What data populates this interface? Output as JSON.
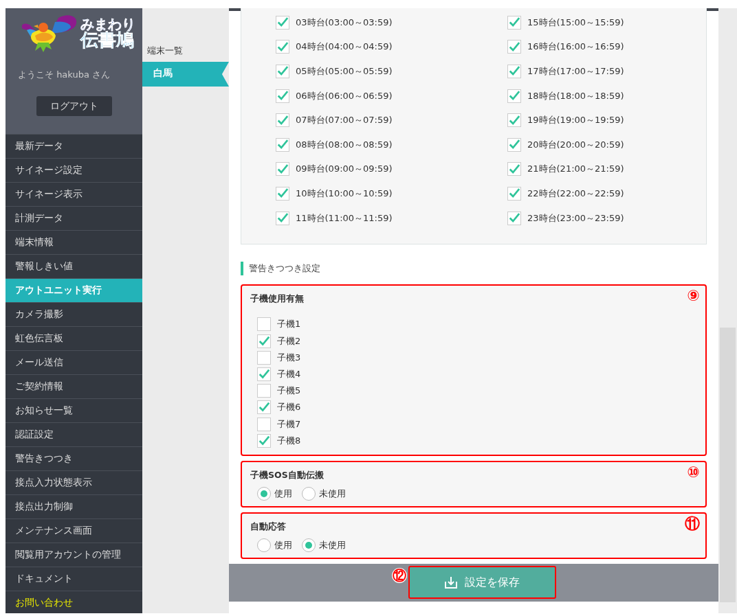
{
  "logo": {
    "line1": "みまわり",
    "line2": "伝書鳩"
  },
  "welcome": "ようこそ hakuba さん",
  "logout": "ログアウト",
  "menu": [
    {
      "label": "最新データ",
      "selected": false,
      "kind": "normal"
    },
    {
      "label": "サイネージ設定",
      "selected": false,
      "kind": "normal"
    },
    {
      "label": "サイネージ表示",
      "selected": false,
      "kind": "normal"
    },
    {
      "label": "計測データ",
      "selected": false,
      "kind": "normal"
    },
    {
      "label": "端末情報",
      "selected": false,
      "kind": "normal"
    },
    {
      "label": "警報しきい値",
      "selected": false,
      "kind": "normal"
    },
    {
      "label": "アウトユニット実行",
      "selected": true,
      "kind": "normal"
    },
    {
      "label": "カメラ撮影",
      "selected": false,
      "kind": "normal"
    },
    {
      "label": "虹色伝言板",
      "selected": false,
      "kind": "normal"
    },
    {
      "label": "メール送信",
      "selected": false,
      "kind": "normal"
    },
    {
      "label": "ご契約情報",
      "selected": false,
      "kind": "normal"
    },
    {
      "label": "お知らせ一覧",
      "selected": false,
      "kind": "normal"
    },
    {
      "label": "認証設定",
      "selected": false,
      "kind": "normal"
    },
    {
      "label": "警告きつつき",
      "selected": false,
      "kind": "normal"
    },
    {
      "label": "接点入力状態表示",
      "selected": false,
      "kind": "normal"
    },
    {
      "label": "接点出力制御",
      "selected": false,
      "kind": "normal"
    },
    {
      "label": "メンテナンス画面",
      "selected": false,
      "kind": "normal"
    },
    {
      "label": "閲覧用アカウントの管理",
      "selected": false,
      "kind": "normal"
    },
    {
      "label": "ドキュメント",
      "selected": false,
      "kind": "normal"
    },
    {
      "label": "お問い合わせ",
      "selected": false,
      "kind": "contact"
    }
  ],
  "terminal_list": {
    "title": "端末一覧",
    "items": [
      {
        "label": "白馬",
        "selected": true
      }
    ]
  },
  "hours": [
    {
      "label": "03時台(03:00～03:59)",
      "checked": true
    },
    {
      "label": "04時台(04:00～04:59)",
      "checked": true
    },
    {
      "label": "05時台(05:00～05:59)",
      "checked": true
    },
    {
      "label": "06時台(06:00～06:59)",
      "checked": true
    },
    {
      "label": "07時台(07:00～07:59)",
      "checked": true
    },
    {
      "label": "08時台(08:00～08:59)",
      "checked": true
    },
    {
      "label": "09時台(09:00～09:59)",
      "checked": true
    },
    {
      "label": "10時台(10:00～10:59)",
      "checked": true
    },
    {
      "label": "11時台(11:00～11:59)",
      "checked": true
    },
    {
      "label": "15時台(15:00～15:59)",
      "checked": true
    },
    {
      "label": "16時台(16:00～16:59)",
      "checked": true
    },
    {
      "label": "17時台(17:00～17:59)",
      "checked": true
    },
    {
      "label": "18時台(18:00～18:59)",
      "checked": true
    },
    {
      "label": "19時台(19:00～19:59)",
      "checked": true
    },
    {
      "label": "20時台(20:00～20:59)",
      "checked": true
    },
    {
      "label": "21時台(21:00～21:59)",
      "checked": true
    },
    {
      "label": "22時台(22:00～22:59)",
      "checked": true
    },
    {
      "label": "23時台(23:00～23:59)",
      "checked": true
    }
  ],
  "section_title": "警告きつつき設定",
  "groups": [
    {
      "kind": "checkboxes",
      "title": "子機使用有無",
      "marker": "⑨",
      "options": [
        {
          "label": "子機1",
          "checked": false
        },
        {
          "label": "子機2",
          "checked": true
        },
        {
          "label": "子機3",
          "checked": false
        },
        {
          "label": "子機4",
          "checked": true
        },
        {
          "label": "子機5",
          "checked": false
        },
        {
          "label": "子機6",
          "checked": true
        },
        {
          "label": "子機7",
          "checked": false
        },
        {
          "label": "子機8",
          "checked": true
        }
      ]
    },
    {
      "kind": "radios",
      "title": "子機SOS自動伝搬",
      "marker": "⑩",
      "options": [
        {
          "label": "使用",
          "selected": true
        },
        {
          "label": "未使用",
          "selected": false
        }
      ]
    },
    {
      "kind": "radios",
      "title": "自動応答",
      "marker": "⑪",
      "options": [
        {
          "label": "使用",
          "selected": false
        },
        {
          "label": "未使用",
          "selected": true
        }
      ]
    }
  ],
  "save": {
    "marker": "⑫",
    "label": "設定を保存"
  }
}
